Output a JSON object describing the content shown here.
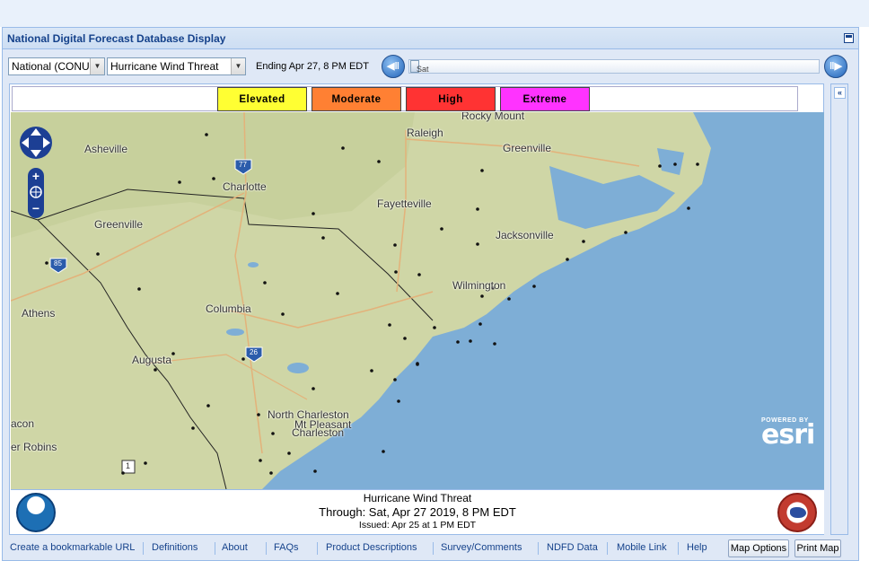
{
  "window": {
    "title": "National Digital Forecast Database Display"
  },
  "toolbar": {
    "region_select": "National (CONUS)",
    "product_select": "Hurricane Wind Threat",
    "ending_text": "Ending Apr 27,   8 PM EDT",
    "slider_label": "Sat",
    "prev_icon": "step-back-icon",
    "next_icon": "step-forward-icon"
  },
  "legend": [
    {
      "label": "Elevated",
      "color": "#ffff33"
    },
    {
      "label": "Moderate",
      "color": "#ff8033"
    },
    {
      "label": "High",
      "color": "#ff3333"
    },
    {
      "label": "Extreme",
      "color": "#ff33ff"
    }
  ],
  "map": {
    "places": [
      "Rocky Mount",
      "Raleigh",
      "Greenville",
      "Asheville",
      "Charlotte",
      "Fayetteville",
      "Greenville",
      "Jacksonville",
      "Wilmington",
      "Athens",
      "Columbia",
      "Augusta",
      "North Charleston",
      "Mt Pleasant",
      "Charleston",
      "acon",
      "er Robins"
    ],
    "interstates": [
      "77",
      "85",
      "26",
      "1"
    ],
    "esri_top": "POWERED BY",
    "esri_logo": "esri",
    "zoom_in": "+",
    "zoom_out": "−"
  },
  "map_footer": {
    "title": "Hurricane Wind Threat",
    "through": "Through: Sat, Apr 27 2019,    8 PM EDT",
    "issued": "Issued: Apr 25 at 1 PM EDT",
    "left_logo": "NOAA",
    "right_logo": "National Weather Service"
  },
  "side_panel": {
    "expand_icon": "«"
  },
  "bottom_links": [
    "Create a bookmarkable URL",
    "Definitions",
    "About",
    "FAQs",
    "Product Descriptions",
    "Survey/Comments",
    "NDFD Data",
    "Mobile Link",
    "Help"
  ],
  "bottom_buttons": {
    "map_options": "Map Options",
    "print_map": "Print Map"
  }
}
